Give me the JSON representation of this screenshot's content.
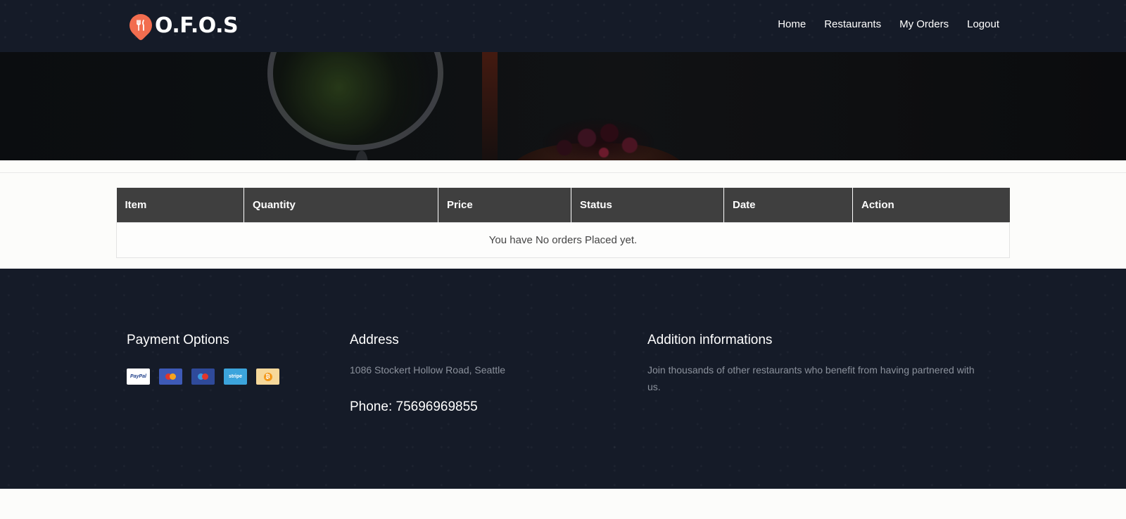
{
  "brand": {
    "name": "O.F.O.S",
    "icon": "fork-knife-icon",
    "accent": "#f26d4f"
  },
  "nav": {
    "items": [
      {
        "label": "Home"
      },
      {
        "label": "Restaurants"
      },
      {
        "label": "My Orders"
      },
      {
        "label": "Logout"
      }
    ]
  },
  "orders": {
    "columns": [
      "Item",
      "Quantity",
      "Price",
      "Status",
      "Date",
      "Action"
    ],
    "empty_message": "You have No orders Placed yet."
  },
  "footer": {
    "payment": {
      "title": "Payment Options",
      "methods": [
        {
          "icon": "paypal-icon",
          "label": "PayPal"
        },
        {
          "icon": "mastercard-icon"
        },
        {
          "icon": "maestro-icon"
        },
        {
          "icon": "stripe-icon",
          "label": "stripe"
        },
        {
          "icon": "bitcoin-icon"
        }
      ]
    },
    "address": {
      "title": "Address",
      "text": "1086 Stockert Hollow Road, Seattle",
      "phone": "Phone: 75696969855"
    },
    "info": {
      "title": "Addition informations",
      "text": "Join thousands of other restaurants who benefit from having partnered with us."
    }
  },
  "colors": {
    "navbar_bg": "#151b28",
    "table_header_bg": "#3f3f3f",
    "page_bg": "#fcfcfa"
  }
}
